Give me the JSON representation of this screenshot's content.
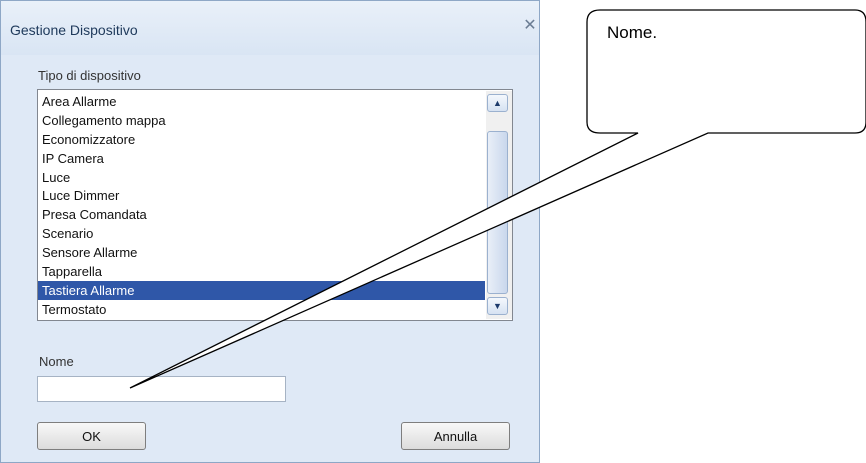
{
  "dialog": {
    "title": "Gestione Dispositivo",
    "close_glyph": "✕",
    "device_type_label": "Tipo di dispositivo",
    "device_types": [
      "Area Allarme",
      "Collegamento mappa",
      "Economizzatore",
      "IP Camera",
      "Luce",
      "Luce Dimmer",
      "Presa Comandata",
      "Scenario",
      "Sensore Allarme",
      "Tapparella",
      "Tastiera Allarme",
      "Termostato"
    ],
    "selected_device_type": "Tastiera Allarme",
    "name_label": "Nome",
    "name_value": "",
    "ok_label": "OK",
    "cancel_label": "Annulla"
  },
  "callout": {
    "text": "Nome."
  },
  "colors": {
    "selection": "#2f57a8",
    "dialog_background": "#dfe9f6"
  },
  "icons": {
    "close": "close-icon",
    "scroll_up": "chevron-up-icon",
    "scroll_down": "chevron-down-icon"
  }
}
